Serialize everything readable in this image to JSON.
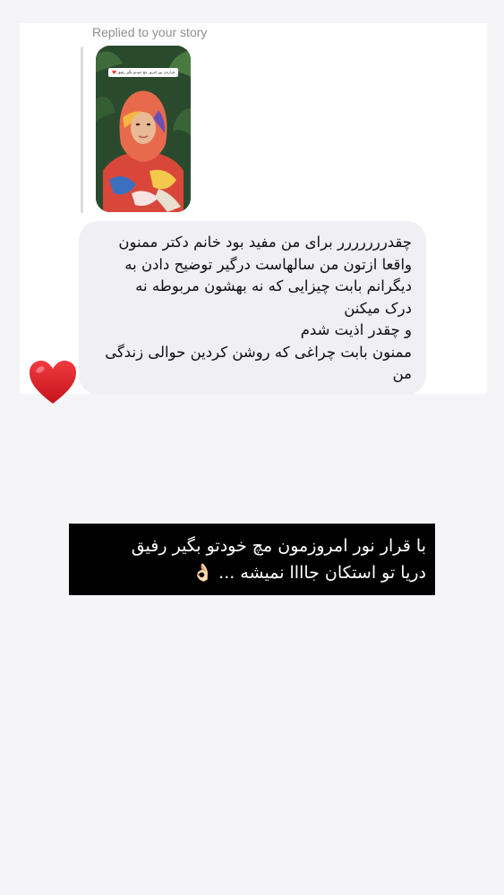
{
  "reply_header": {
    "label": "Replied to your story"
  },
  "story_preview": {
    "caption": "قراره‌ی نور امروز مچ خودتو بگیر رفیق ❤️"
  },
  "message": {
    "lines": [
      "چقدررررررر برای من مفید بود خانم دکتر ممنون",
      "واقعا ازتون من سالهاست درگیر توضیح دادن به",
      "دیگرانم بابت چیزایی که نه بهشون مربوطه نه",
      "درک میکنن",
      "و چقدر اذیت شدم",
      "ممنون بابت چراغی که روشن کردین حوالی زندگی",
      "من"
    ]
  },
  "reaction": {
    "icon": "red-heart-icon",
    "color": "#e0202a"
  },
  "overlay_banner": {
    "lines": [
      "با قرار نور امروزمون مچ خودتو بگیر رفیق",
      "دریا تو استکان جاااا نمیشه ... 👌🏻"
    ]
  }
}
